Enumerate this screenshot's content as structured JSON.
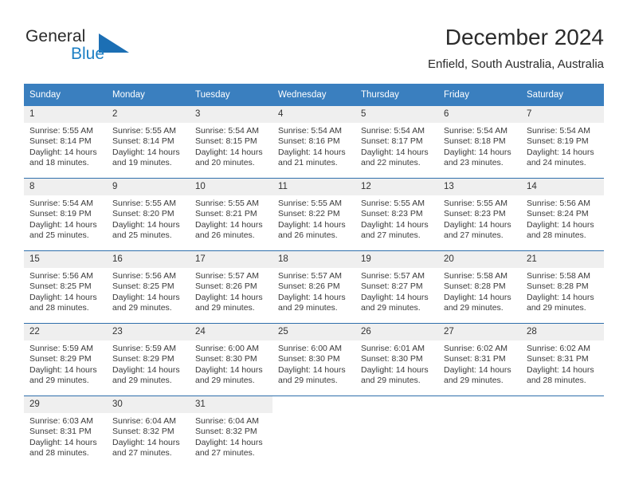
{
  "brand": {
    "name_part1": "General",
    "name_part2": "Blue",
    "flag_icon": "blue-triangle-flag-icon",
    "accent_color": "#1c7fc4"
  },
  "header": {
    "title": "December 2024",
    "subtitle": "Enfield, South Australia, Australia"
  },
  "calendar": {
    "header_bg": "#3a7fbf",
    "row_separator_color": "#2f6fab",
    "daynum_bg": "#efefef",
    "weekday_headers": [
      "Sunday",
      "Monday",
      "Tuesday",
      "Wednesday",
      "Thursday",
      "Friday",
      "Saturday"
    ],
    "weeks": [
      [
        {
          "day": "1",
          "sunrise": "Sunrise: 5:55 AM",
          "sunset": "Sunset: 8:14 PM",
          "daylight_line1": "Daylight: 14 hours",
          "daylight_line2": "and 18 minutes."
        },
        {
          "day": "2",
          "sunrise": "Sunrise: 5:55 AM",
          "sunset": "Sunset: 8:14 PM",
          "daylight_line1": "Daylight: 14 hours",
          "daylight_line2": "and 19 minutes."
        },
        {
          "day": "3",
          "sunrise": "Sunrise: 5:54 AM",
          "sunset": "Sunset: 8:15 PM",
          "daylight_line1": "Daylight: 14 hours",
          "daylight_line2": "and 20 minutes."
        },
        {
          "day": "4",
          "sunrise": "Sunrise: 5:54 AM",
          "sunset": "Sunset: 8:16 PM",
          "daylight_line1": "Daylight: 14 hours",
          "daylight_line2": "and 21 minutes."
        },
        {
          "day": "5",
          "sunrise": "Sunrise: 5:54 AM",
          "sunset": "Sunset: 8:17 PM",
          "daylight_line1": "Daylight: 14 hours",
          "daylight_line2": "and 22 minutes."
        },
        {
          "day": "6",
          "sunrise": "Sunrise: 5:54 AM",
          "sunset": "Sunset: 8:18 PM",
          "daylight_line1": "Daylight: 14 hours",
          "daylight_line2": "and 23 minutes."
        },
        {
          "day": "7",
          "sunrise": "Sunrise: 5:54 AM",
          "sunset": "Sunset: 8:19 PM",
          "daylight_line1": "Daylight: 14 hours",
          "daylight_line2": "and 24 minutes."
        }
      ],
      [
        {
          "day": "8",
          "sunrise": "Sunrise: 5:54 AM",
          "sunset": "Sunset: 8:19 PM",
          "daylight_line1": "Daylight: 14 hours",
          "daylight_line2": "and 25 minutes."
        },
        {
          "day": "9",
          "sunrise": "Sunrise: 5:55 AM",
          "sunset": "Sunset: 8:20 PM",
          "daylight_line1": "Daylight: 14 hours",
          "daylight_line2": "and 25 minutes."
        },
        {
          "day": "10",
          "sunrise": "Sunrise: 5:55 AM",
          "sunset": "Sunset: 8:21 PM",
          "daylight_line1": "Daylight: 14 hours",
          "daylight_line2": "and 26 minutes."
        },
        {
          "day": "11",
          "sunrise": "Sunrise: 5:55 AM",
          "sunset": "Sunset: 8:22 PM",
          "daylight_line1": "Daylight: 14 hours",
          "daylight_line2": "and 26 minutes."
        },
        {
          "day": "12",
          "sunrise": "Sunrise: 5:55 AM",
          "sunset": "Sunset: 8:23 PM",
          "daylight_line1": "Daylight: 14 hours",
          "daylight_line2": "and 27 minutes."
        },
        {
          "day": "13",
          "sunrise": "Sunrise: 5:55 AM",
          "sunset": "Sunset: 8:23 PM",
          "daylight_line1": "Daylight: 14 hours",
          "daylight_line2": "and 27 minutes."
        },
        {
          "day": "14",
          "sunrise": "Sunrise: 5:56 AM",
          "sunset": "Sunset: 8:24 PM",
          "daylight_line1": "Daylight: 14 hours",
          "daylight_line2": "and 28 minutes."
        }
      ],
      [
        {
          "day": "15",
          "sunrise": "Sunrise: 5:56 AM",
          "sunset": "Sunset: 8:25 PM",
          "daylight_line1": "Daylight: 14 hours",
          "daylight_line2": "and 28 minutes."
        },
        {
          "day": "16",
          "sunrise": "Sunrise: 5:56 AM",
          "sunset": "Sunset: 8:25 PM",
          "daylight_line1": "Daylight: 14 hours",
          "daylight_line2": "and 29 minutes."
        },
        {
          "day": "17",
          "sunrise": "Sunrise: 5:57 AM",
          "sunset": "Sunset: 8:26 PM",
          "daylight_line1": "Daylight: 14 hours",
          "daylight_line2": "and 29 minutes."
        },
        {
          "day": "18",
          "sunrise": "Sunrise: 5:57 AM",
          "sunset": "Sunset: 8:26 PM",
          "daylight_line1": "Daylight: 14 hours",
          "daylight_line2": "and 29 minutes."
        },
        {
          "day": "19",
          "sunrise": "Sunrise: 5:57 AM",
          "sunset": "Sunset: 8:27 PM",
          "daylight_line1": "Daylight: 14 hours",
          "daylight_line2": "and 29 minutes."
        },
        {
          "day": "20",
          "sunrise": "Sunrise: 5:58 AM",
          "sunset": "Sunset: 8:28 PM",
          "daylight_line1": "Daylight: 14 hours",
          "daylight_line2": "and 29 minutes."
        },
        {
          "day": "21",
          "sunrise": "Sunrise: 5:58 AM",
          "sunset": "Sunset: 8:28 PM",
          "daylight_line1": "Daylight: 14 hours",
          "daylight_line2": "and 29 minutes."
        }
      ],
      [
        {
          "day": "22",
          "sunrise": "Sunrise: 5:59 AM",
          "sunset": "Sunset: 8:29 PM",
          "daylight_line1": "Daylight: 14 hours",
          "daylight_line2": "and 29 minutes."
        },
        {
          "day": "23",
          "sunrise": "Sunrise: 5:59 AM",
          "sunset": "Sunset: 8:29 PM",
          "daylight_line1": "Daylight: 14 hours",
          "daylight_line2": "and 29 minutes."
        },
        {
          "day": "24",
          "sunrise": "Sunrise: 6:00 AM",
          "sunset": "Sunset: 8:30 PM",
          "daylight_line1": "Daylight: 14 hours",
          "daylight_line2": "and 29 minutes."
        },
        {
          "day": "25",
          "sunrise": "Sunrise: 6:00 AM",
          "sunset": "Sunset: 8:30 PM",
          "daylight_line1": "Daylight: 14 hours",
          "daylight_line2": "and 29 minutes."
        },
        {
          "day": "26",
          "sunrise": "Sunrise: 6:01 AM",
          "sunset": "Sunset: 8:30 PM",
          "daylight_line1": "Daylight: 14 hours",
          "daylight_line2": "and 29 minutes."
        },
        {
          "day": "27",
          "sunrise": "Sunrise: 6:02 AM",
          "sunset": "Sunset: 8:31 PM",
          "daylight_line1": "Daylight: 14 hours",
          "daylight_line2": "and 29 minutes."
        },
        {
          "day": "28",
          "sunrise": "Sunrise: 6:02 AM",
          "sunset": "Sunset: 8:31 PM",
          "daylight_line1": "Daylight: 14 hours",
          "daylight_line2": "and 28 minutes."
        }
      ],
      [
        {
          "day": "29",
          "sunrise": "Sunrise: 6:03 AM",
          "sunset": "Sunset: 8:31 PM",
          "daylight_line1": "Daylight: 14 hours",
          "daylight_line2": "and 28 minutes."
        },
        {
          "day": "30",
          "sunrise": "Sunrise: 6:04 AM",
          "sunset": "Sunset: 8:32 PM",
          "daylight_line1": "Daylight: 14 hours",
          "daylight_line2": "and 27 minutes."
        },
        {
          "day": "31",
          "sunrise": "Sunrise: 6:04 AM",
          "sunset": "Sunset: 8:32 PM",
          "daylight_line1": "Daylight: 14 hours",
          "daylight_line2": "and 27 minutes."
        },
        {
          "day": "",
          "sunrise": "",
          "sunset": "",
          "daylight_line1": "",
          "daylight_line2": ""
        },
        {
          "day": "",
          "sunrise": "",
          "sunset": "",
          "daylight_line1": "",
          "daylight_line2": ""
        },
        {
          "day": "",
          "sunrise": "",
          "sunset": "",
          "daylight_line1": "",
          "daylight_line2": ""
        },
        {
          "day": "",
          "sunrise": "",
          "sunset": "",
          "daylight_line1": "",
          "daylight_line2": ""
        }
      ]
    ]
  }
}
